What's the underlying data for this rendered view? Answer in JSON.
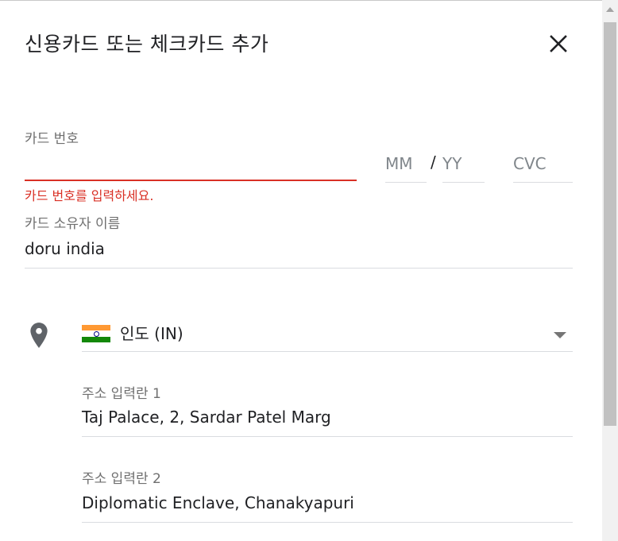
{
  "dialog": {
    "title": "신용카드 또는 체크카드 추가"
  },
  "card_number": {
    "label": "카드 번호",
    "value": "",
    "error": "카드 번호를 입력하세요."
  },
  "expiry": {
    "month_placeholder": "MM",
    "separator": "/",
    "year_placeholder": "YY"
  },
  "cvc": {
    "placeholder": "CVC"
  },
  "cardholder": {
    "label": "카드 소유자 이름",
    "value": "doru india"
  },
  "country": {
    "value": "인도 (IN)",
    "flag": "india-flag"
  },
  "address1": {
    "label": "주소 입력란 1",
    "value": "Taj Palace, 2, Sardar Patel Marg"
  },
  "address2": {
    "label": "주소 입력란 2",
    "value": "Diplomatic Enclave, Chanakyapuri"
  },
  "icons": {
    "close": "close-icon",
    "location": "location-pin-icon",
    "dropdown": "chevron-down-icon"
  },
  "colors": {
    "error": "#d93025",
    "text": "#202124",
    "label": "#6f6f6f",
    "underline": "#dadce0"
  }
}
